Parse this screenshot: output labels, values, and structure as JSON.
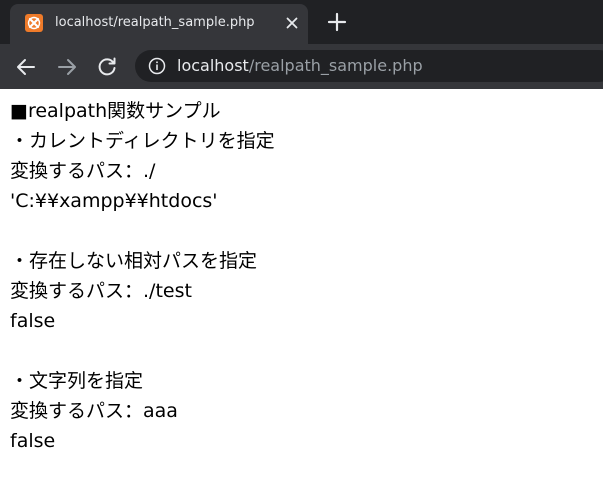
{
  "browser": {
    "tab": {
      "title": "localhost/realpath_sample.php",
      "favicon": "xampp-icon",
      "favicon_color": "#ef7b2a"
    },
    "address_bar": {
      "host": "localhost",
      "path": "/realpath_sample.php"
    },
    "icons": {
      "close": "close-icon",
      "new_tab": "plus-icon",
      "back": "arrow-left-icon",
      "forward": "arrow-right-icon",
      "reload": "reload-icon",
      "site_info": "info-icon"
    },
    "colors": {
      "frame": "#202124",
      "toolbar": "#35363a",
      "text": "#e8eaed",
      "muted": "#9aa0a6"
    }
  },
  "page": {
    "lines": [
      "■realpath関数サンプル",
      "・カレントディレクトリを指定",
      "変換するパス：./",
      "'C:¥¥xampp¥¥htdocs'",
      "",
      "・存在しない相対パスを指定",
      "変換するパス：./test",
      "false",
      "",
      "・文字列を指定",
      "変換するパス：aaa",
      "false"
    ]
  }
}
